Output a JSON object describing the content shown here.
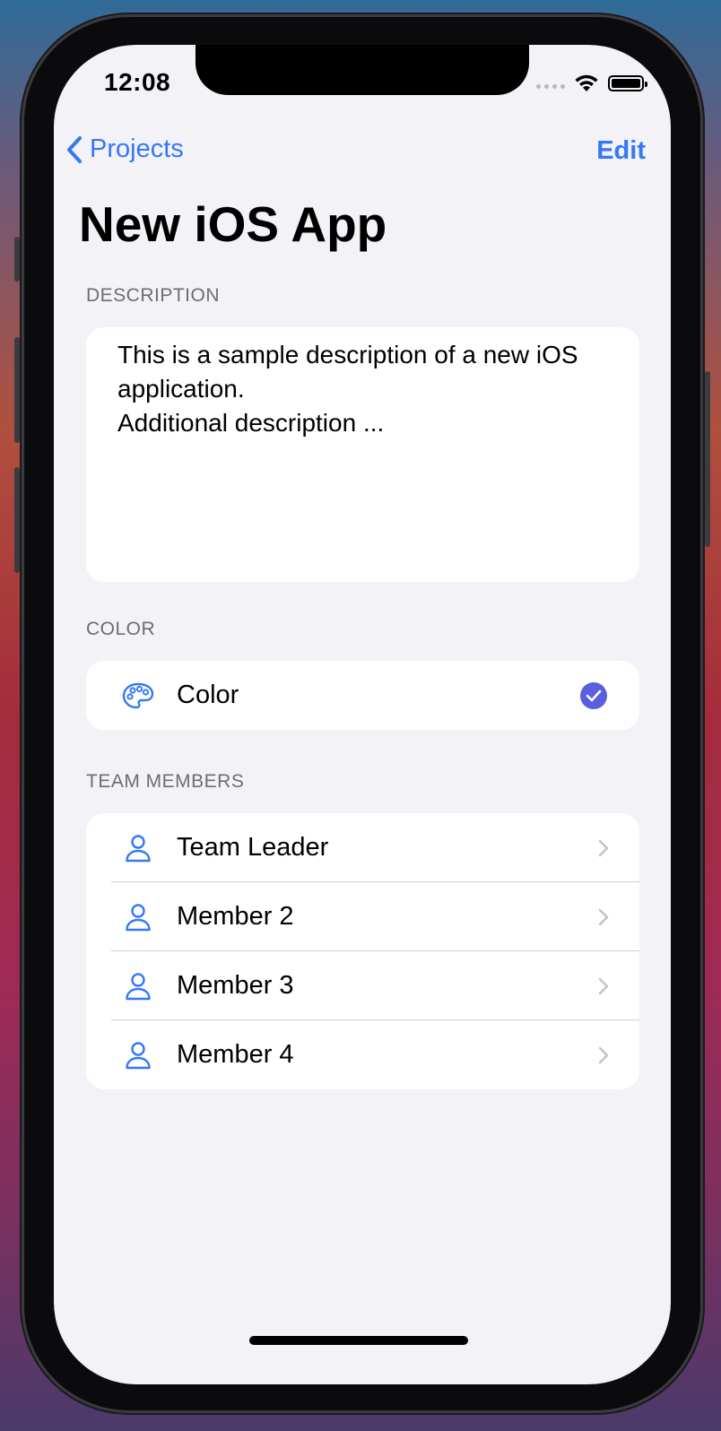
{
  "status_bar": {
    "time": "12:08"
  },
  "nav": {
    "back_label": "Projects",
    "edit_label": "Edit"
  },
  "page": {
    "title": "New iOS App"
  },
  "description": {
    "header": "DESCRIPTION",
    "text": "This is a sample description of a new iOS application.\nAdditional description ..."
  },
  "color": {
    "header": "COLOR",
    "label": "Color",
    "selected": true,
    "icon": "palette-icon",
    "check_color": "#5a5fe0"
  },
  "team": {
    "header": "TEAM MEMBERS",
    "members": [
      {
        "name": "Team Leader",
        "icon": "person-icon"
      },
      {
        "name": "Member 2",
        "icon": "person-icon"
      },
      {
        "name": "Member 3",
        "icon": "person-icon"
      },
      {
        "name": "Member 4",
        "icon": "person-icon"
      }
    ]
  },
  "colors": {
    "accent": "#3478f6",
    "background": "#f2f2f7"
  }
}
